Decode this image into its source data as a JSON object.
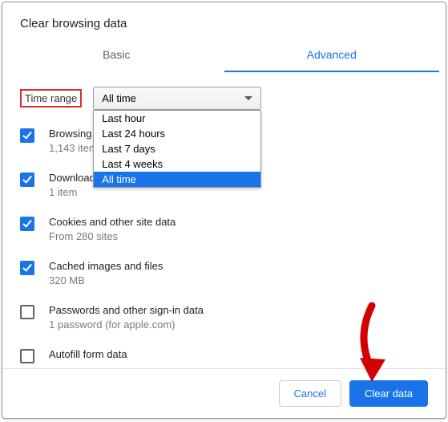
{
  "title": "Clear browsing data",
  "tabs": {
    "basic": "Basic",
    "advanced": "Advanced"
  },
  "time": {
    "label": "Time range",
    "selected": "All time",
    "options": [
      "Last hour",
      "Last 24 hours",
      "Last 7 days",
      "Last 4 weeks",
      "All time"
    ]
  },
  "items": [
    {
      "label": "Browsing history",
      "sub": "1,143 items",
      "checked": true
    },
    {
      "label": "Download history",
      "sub": "1 item",
      "checked": true
    },
    {
      "label": "Cookies and other site data",
      "sub": "From 280 sites",
      "checked": true
    },
    {
      "label": "Cached images and files",
      "sub": "320 MB",
      "checked": true
    },
    {
      "label": "Passwords and other sign-in data",
      "sub": "1 password (for apple.com)",
      "checked": false
    },
    {
      "label": "Autofill form data",
      "sub": "",
      "checked": false
    }
  ],
  "buttons": {
    "cancel": "Cancel",
    "clear": "Clear data"
  }
}
